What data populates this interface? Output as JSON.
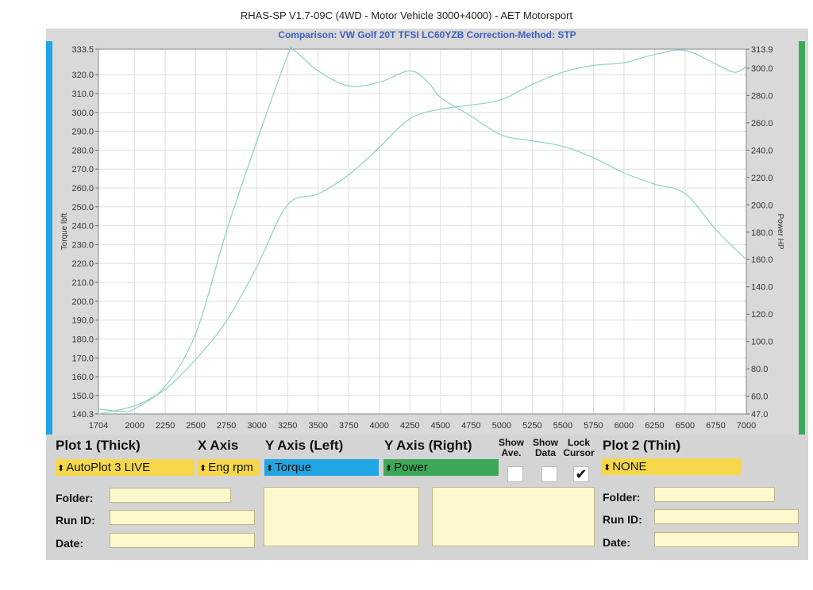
{
  "title": "RHAS-SP V1.7-09C  (4WD - Motor Vehicle 3000+4000) - AET Motorsport",
  "subtitle": "Comparison: VW Golf 20T TFSI LC60YZB    Correction-Method: STP",
  "colors": {
    "torque_axis": "#22a5e3",
    "power_axis": "#3ea859",
    "curve": "#8ed1c4",
    "plot_background": "#ffffff",
    "grid": "#dddddd"
  },
  "chart_data": {
    "type": "line",
    "xlabel": "",
    "ylabel_left": "Torque lbft",
    "ylabel_right": "Power HP",
    "x_ticks": [
      "1704",
      "2000",
      "2250",
      "2500",
      "2750",
      "3000",
      "3250",
      "3500",
      "3750",
      "4000",
      "4250",
      "4500",
      "4750",
      "5000",
      "5250",
      "5500",
      "5750",
      "6000",
      "6250",
      "6500",
      "6750",
      "7000"
    ],
    "y_left_ticks": [
      "140.3",
      "150.0",
      "160.0",
      "170.0",
      "180.0",
      "190.0",
      "200.0",
      "210.0",
      "220.0",
      "230.0",
      "240.0",
      "250.0",
      "260.0",
      "270.0",
      "280.0",
      "290.0",
      "300.0",
      "310.0",
      "320.0",
      "333.5"
    ],
    "y_right_ticks": [
      "47.0",
      "60.0",
      "80.0",
      "100.0",
      "120.0",
      "140.0",
      "160.0",
      "180.0",
      "200.0",
      "220.0",
      "240.0",
      "260.0",
      "280.0",
      "300.0",
      "313.9"
    ],
    "xlim": [
      1704,
      7000
    ],
    "ylim_left": [
      140.3,
      333.5
    ],
    "ylim_right": [
      47.0,
      313.9
    ],
    "grid": true,
    "series": [
      {
        "name": "Torque",
        "axis": "left",
        "x": [
          1704,
          1900,
          2000,
          2250,
          2500,
          2750,
          3000,
          3250,
          3300,
          3500,
          3750,
          4000,
          4250,
          4400,
          4500,
          4750,
          5000,
          5250,
          5500,
          5750,
          6000,
          6250,
          6500,
          6750,
          7000
        ],
        "y": [
          143,
          141.5,
          143,
          155,
          183,
          237,
          285,
          330,
          333,
          322,
          314,
          316,
          322,
          316,
          308,
          298,
          288,
          285,
          282,
          276,
          268,
          262,
          257,
          238,
          222
        ]
      },
      {
        "name": "Power",
        "axis": "right",
        "x": [
          1704,
          2000,
          2250,
          2500,
          2750,
          3000,
          3250,
          3500,
          3750,
          4000,
          4250,
          4500,
          4750,
          5000,
          5250,
          5500,
          5750,
          6000,
          6250,
          6500,
          6750,
          6900,
          7000
        ],
        "y": [
          47,
          53,
          65,
          87,
          115,
          155,
          200,
          208,
          222,
          242,
          263,
          270,
          273,
          277,
          288,
          297,
          302,
          304,
          310,
          313,
          303,
          297,
          301
        ]
      }
    ]
  },
  "panel": {
    "plot1_header": "Plot 1 (Thick)",
    "xaxis_header": "X Axis",
    "yleft_header": "Y Axis (Left)",
    "yright_header": "Y Axis (Right)",
    "show_ave_header": "Show Ave.",
    "show_data_header": "Show Data",
    "lock_cursor_header": "Lock Cursor",
    "plot2_header": "Plot 2 (Thin)",
    "plot1_value": "AutoPlot 3 LIVE",
    "xaxis_value": "Eng rpm",
    "yleft_value": "Torque",
    "yright_value": "Power",
    "plot2_value": "NONE",
    "show_ave_checked": false,
    "show_data_checked": false,
    "lock_cursor_checked": true,
    "check_mark": "✔",
    "selector_arrow": "⬍",
    "left_fields": {
      "folder_label": "Folder:",
      "runid_label": "Run ID:",
      "date_label": "Date:",
      "folder_value": "",
      "runid_value": "",
      "date_value": ""
    },
    "right_fields": {
      "folder_label": "Folder:",
      "runid_label": "Run ID:",
      "date_label": "Date:",
      "folder_value": "",
      "runid_value": "",
      "date_value": ""
    },
    "notes_left": "",
    "notes_right": ""
  }
}
